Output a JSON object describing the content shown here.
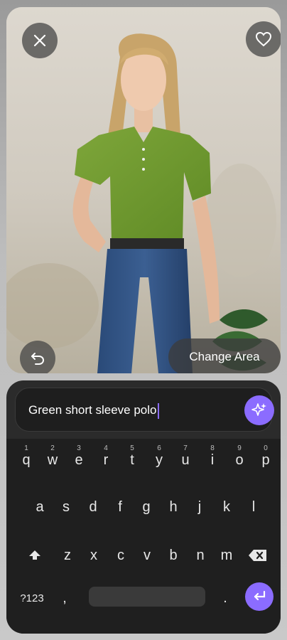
{
  "photo": {
    "change_area_label": "Change Area"
  },
  "prompt": {
    "value": "Green short sleeve polo"
  },
  "keyboard": {
    "row1": [
      {
        "k": "q",
        "n": "1"
      },
      {
        "k": "w",
        "n": "2"
      },
      {
        "k": "e",
        "n": "3"
      },
      {
        "k": "r",
        "n": "4"
      },
      {
        "k": "t",
        "n": "5"
      },
      {
        "k": "y",
        "n": "6"
      },
      {
        "k": "u",
        "n": "7"
      },
      {
        "k": "i",
        "n": "8"
      },
      {
        "k": "o",
        "n": "9"
      },
      {
        "k": "p",
        "n": "0"
      }
    ],
    "row2": [
      "a",
      "s",
      "d",
      "f",
      "g",
      "h",
      "j",
      "k",
      "l"
    ],
    "row3": [
      "z",
      "x",
      "c",
      "v",
      "b",
      "n",
      "m"
    ],
    "symbols_label": "?123",
    "comma": ",",
    "period": "."
  }
}
